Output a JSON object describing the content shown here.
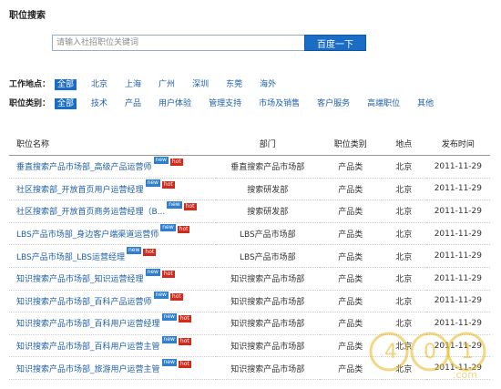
{
  "page_title": "职位搜索",
  "search": {
    "placeholder": "请输入社招职位关键词",
    "button_label": "百度一下"
  },
  "location_filter": {
    "label": "工作地点：",
    "options": [
      "全部",
      "北京",
      "上海",
      "广州",
      "深圳",
      "东莞",
      "海外"
    ],
    "selected": "全部"
  },
  "category_filter": {
    "label": "职位类别：",
    "options": [
      "全部",
      "技术",
      "产品",
      "用户体验",
      "管理支持",
      "市场及销售",
      "客户服务",
      "高端职位",
      "其他"
    ],
    "selected": "全部"
  },
  "table": {
    "headers": [
      "职位名称",
      "部门",
      "职位类别",
      "地点",
      "发布时间"
    ],
    "badge_new": "new",
    "badge_hot": "hot",
    "rows": [
      {
        "title": "垂直搜索产品市场部_高级产品运营师",
        "dept": "垂直搜索产品市场部",
        "category": "产品类",
        "location": "北京",
        "date": "2011-11-29"
      },
      {
        "title": "社区搜索部_开放首页用户运营经理",
        "dept": "搜索研发部",
        "category": "产品类",
        "location": "北京",
        "date": "2011-11-29"
      },
      {
        "title": "社区搜索部_开放首页商务运营经理（B...",
        "dept": "搜索研发部",
        "category": "产品类",
        "location": "北京",
        "date": "2011-11-29"
      },
      {
        "title": "LBS产品市场部_身边客户端渠道运营师",
        "dept": "LBS产品市场部",
        "category": "产品类",
        "location": "北京",
        "date": "2011-11-29"
      },
      {
        "title": "LBS产品市场部_LBS运营经理",
        "dept": "LBS产品市场部",
        "category": "产品类",
        "location": "北京",
        "date": "2011-11-29"
      },
      {
        "title": "知识搜索产品市场部_知识运营经理",
        "dept": "知识搜索产品市场部",
        "category": "产品类",
        "location": "北京",
        "date": "2011-11-29"
      },
      {
        "title": "知识搜索产品市场部_百科产品运营师",
        "dept": "知识搜索产品市场部",
        "category": "产品类",
        "location": "北京",
        "date": "2011-11-29"
      },
      {
        "title": "知识搜索产品市场部_百科用户运营经理",
        "dept": "知识搜索产品市场部",
        "category": "产品类",
        "location": "北京",
        "date": "2011-11-29"
      },
      {
        "title": "知识搜索产品市场部_百科用户运营主管",
        "dept": "知识搜索产品市场部",
        "category": "产品类",
        "location": "北京",
        "date": "2011-11-29"
      },
      {
        "title": "知识搜索产品市场部_旅游用户运营主管",
        "dept": "知识搜索产品市场部",
        "category": "产品类",
        "location": "北京",
        "date": "2011-11-29"
      }
    ]
  },
  "watermark": {
    "text": "4 0 1 .com",
    "color": "#e8b820"
  }
}
